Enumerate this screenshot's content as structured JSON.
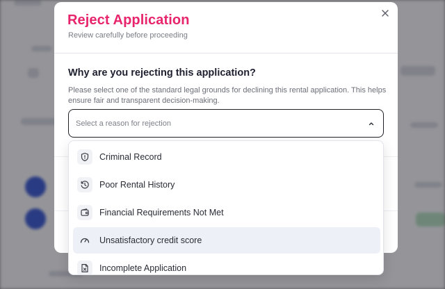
{
  "modal": {
    "title": "Reject Application",
    "subtitle": "Review carefully before proceeding",
    "question": "Why are you rejecting this application?",
    "help_text": "Please select one of the standard legal grounds for declining this rental application. This helps ensure fair and transparent decision-making.",
    "select_placeholder": "Select a reason for rejection",
    "title_color": "#e8256c"
  },
  "dropdown": {
    "options": [
      {
        "label": "Criminal Record",
        "icon": "shield-icon"
      },
      {
        "label": "Poor Rental History",
        "icon": "history-icon"
      },
      {
        "label": "Financial Requirements Not Met",
        "icon": "wallet-icon"
      },
      {
        "label": "Unsatisfactory credit score",
        "icon": "gauge-icon",
        "highlighted": true
      },
      {
        "label": "Incomplete Application",
        "icon": "file-x-icon"
      }
    ]
  }
}
